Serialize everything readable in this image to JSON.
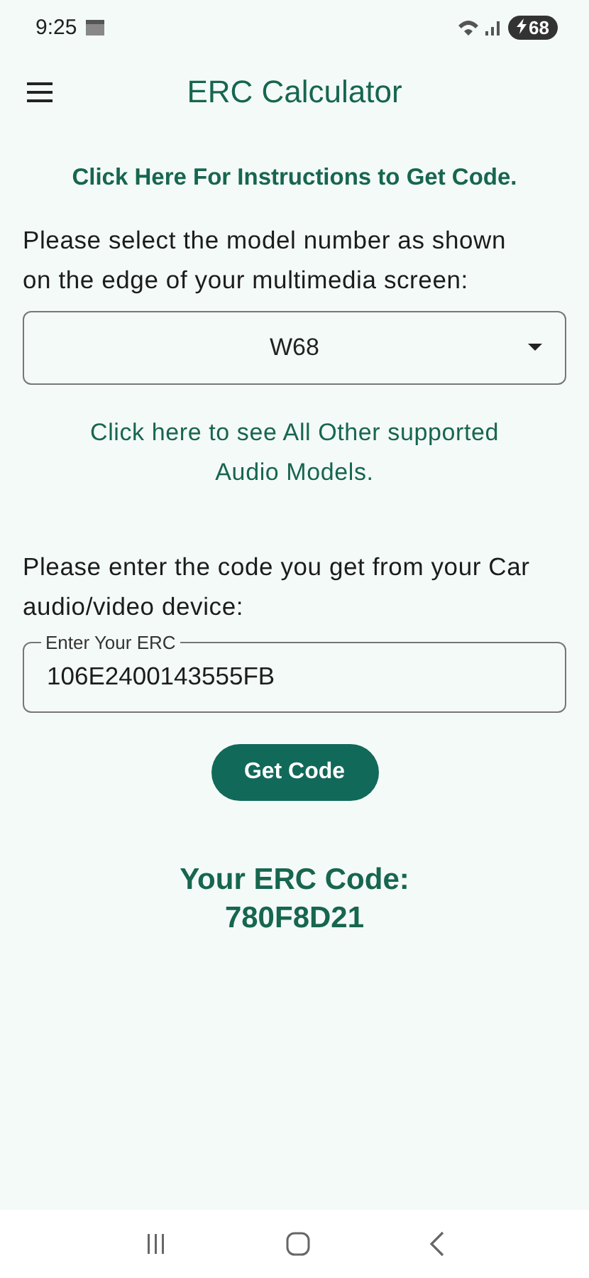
{
  "status_bar": {
    "time": "9:25",
    "battery": "68"
  },
  "app_bar": {
    "title": "ERC Calculator"
  },
  "instructions_link": "Click Here For Instructions to Get Code.",
  "model_prompt": "Please select the model number as shown on the edge of your multimedia screen:",
  "model_select": {
    "value": "W68"
  },
  "models_link": "Click here to see All Other supported Audio Models.",
  "code_prompt": "Please enter the code you get from your Car audio/video device:",
  "code_field": {
    "label": "Enter Your ERC",
    "value": "106E2400143555FB"
  },
  "get_code_button": "Get Code",
  "result": {
    "label": "Your ERC Code:",
    "code": "780F8D21"
  }
}
